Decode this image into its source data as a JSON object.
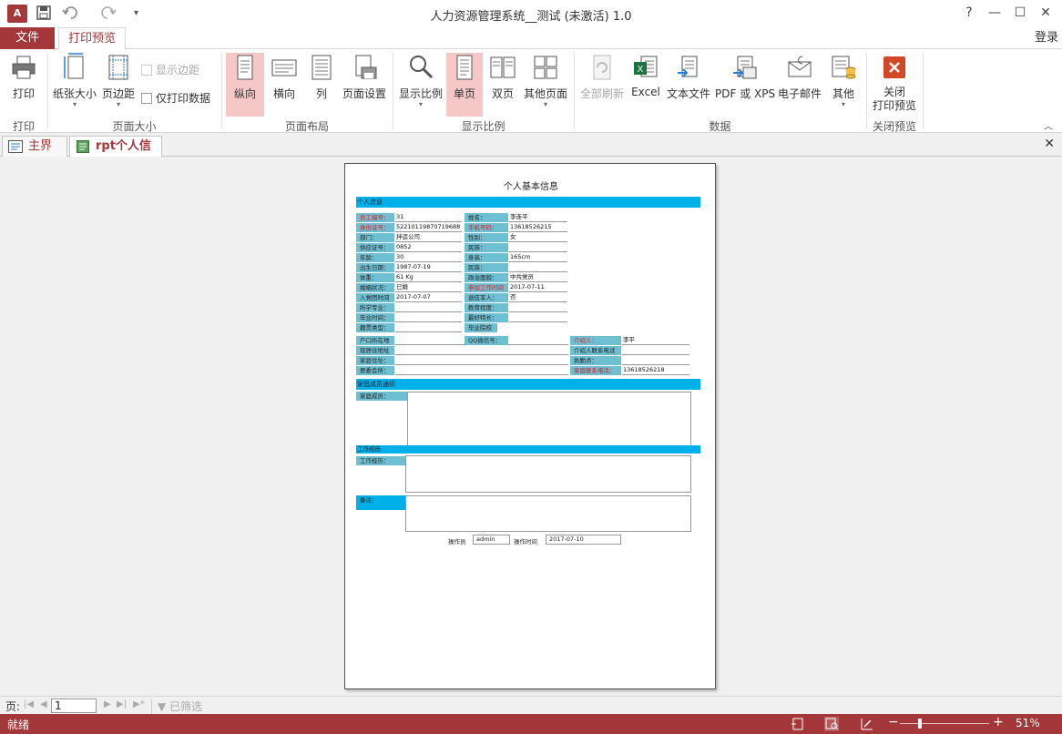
{
  "app": {
    "title": "人力资源管理系统__测试 (未激活) 1.0",
    "logo": "A",
    "help": "?",
    "login": "登录"
  },
  "tabs": {
    "file": "文件",
    "print_preview": "打印预览"
  },
  "ribbon": {
    "print": "打印",
    "paper_size": "纸张大小",
    "margins": "页边距",
    "show_margins": "显示边距",
    "print_data_only": "仅打印数据",
    "portrait": "纵向",
    "landscape": "横向",
    "columns": "列",
    "page_setup": "页面设置",
    "zoom": "显示比例",
    "one_page": "单页",
    "two_pages": "双页",
    "more_pages": "其他页面",
    "refresh_all": "全部刷新",
    "excel": "Excel",
    "text_file": "文本文件",
    "pdf_xps": "PDF 或 XPS",
    "email": "电子邮件",
    "more": "其他",
    "close_line1": "关闭",
    "close_line2": "打印预览",
    "groups": {
      "print": "打印",
      "page_size": "页面大小",
      "page_layout": "页面布局",
      "zoom": "显示比例",
      "data": "数据",
      "close_preview": "关闭预览"
    }
  },
  "doc_tabs": {
    "main": "主界面",
    "report": "rpt个人信息"
  },
  "report": {
    "title": "个人基本信息",
    "section_personal": "个人信息",
    "section_family": "家庭成员通讯",
    "section_work": "工作经历",
    "rows_left": [
      {
        "label": "员工编号：",
        "value": "31",
        "required": true
      },
      {
        "label": "身份证号：",
        "value": "52210119870719688",
        "required": true
      },
      {
        "label": "部门：",
        "value": "拌运公司",
        "required": false
      },
      {
        "label": "供应证号：",
        "value": "0852",
        "required": false
      },
      {
        "label": "年龄：",
        "value": "30",
        "required": false
      },
      {
        "label": "出生日期：",
        "value": "1987-07-19",
        "required": false
      },
      {
        "label": "体重：",
        "value": "61 Kg",
        "required": false
      },
      {
        "label": "婚姻状况：",
        "value": "已婚",
        "required": false
      },
      {
        "label": "入党团时间",
        "value": "2017-07-07",
        "required": false
      },
      {
        "label": "所学专业：",
        "value": "",
        "required": false
      },
      {
        "label": "毕业时间：",
        "value": "",
        "required": false
      },
      {
        "label": "籍贯类型：",
        "value": "",
        "required": false
      }
    ],
    "rows_mid": [
      {
        "label": "姓名：",
        "value": "李连平",
        "required": false
      },
      {
        "label": "手机号码：",
        "value": "13618526215",
        "required": true
      },
      {
        "label": "性别：",
        "value": "女",
        "required": false
      },
      {
        "label": "民族：",
        "value": "",
        "required": false
      },
      {
        "label": "身高：",
        "value": "165cm",
        "required": false
      },
      {
        "label": "民族：",
        "value": "",
        "required": false
      },
      {
        "label": "政治面貌：",
        "value": "中共党员",
        "required": false
      },
      {
        "label": "参加工作时间",
        "value": "2017-07-11",
        "required": true
      },
      {
        "label": "退伍军人：",
        "value": "否",
        "required": false
      },
      {
        "label": "教育程度：",
        "value": "",
        "required": false
      },
      {
        "label": "最好特长：",
        "value": "",
        "required": false
      },
      {
        "label": "毕业院校",
        "value": "",
        "required": false
      }
    ],
    "rows_bottom": [
      {
        "label": "户口所在地",
        "value": ""
      },
      {
        "label": "现居住地址",
        "value": ""
      },
      {
        "label": "家庭住址：",
        "value": ""
      },
      {
        "label": "居委会所：",
        "value": ""
      }
    ],
    "qq_label": "QQ微信号：",
    "qq_value": "",
    "rows_right": [
      {
        "label": "介绍人：",
        "value": "李平",
        "required": true
      },
      {
        "label": "介绍人联系电话",
        "value": "",
        "required": false
      },
      {
        "label": "执勤点：",
        "value": "",
        "required": false
      },
      {
        "label": "家庭联系电话：",
        "value": "13618526218",
        "required": true
      }
    ],
    "family_label": "家庭成员：",
    "work_label": "工作经历：",
    "remark_label": "备注：",
    "operator_label": "操作员",
    "operator_value": "admin",
    "op_time_label": "操作时间",
    "op_time_value": "2017-07-10"
  },
  "navbar": {
    "page_label": "页:",
    "page_value": "1",
    "filter": "已筛选"
  },
  "status": {
    "ready": "就绪",
    "zoom": "51%"
  },
  "colors": {
    "accent": "#a4373a",
    "band": "#00b0e8",
    "label_bg": "#6fbfd3"
  }
}
